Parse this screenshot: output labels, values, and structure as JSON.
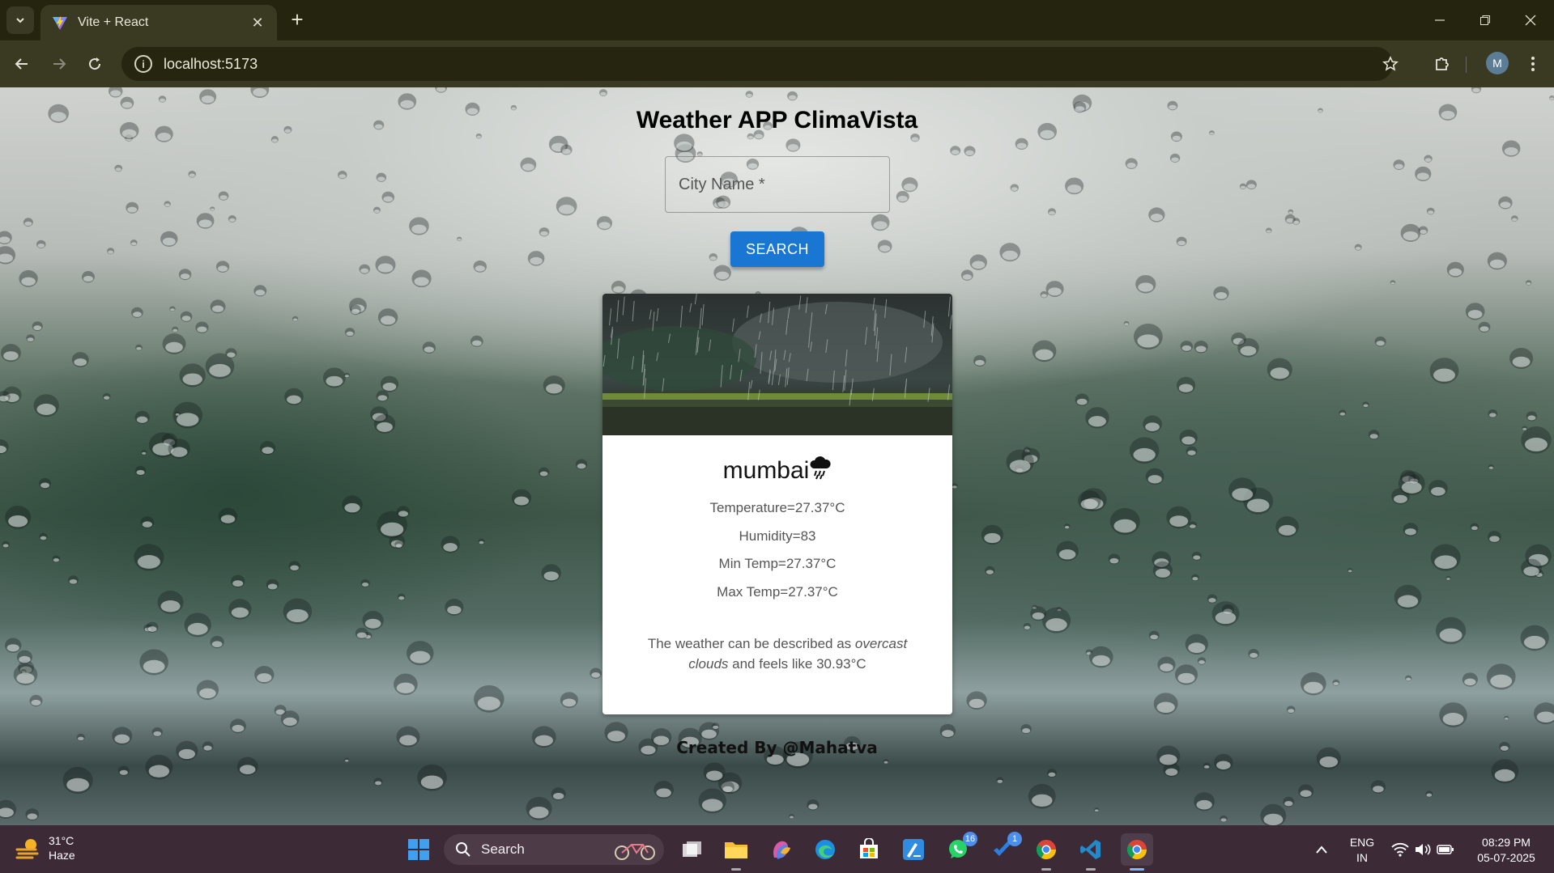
{
  "browser": {
    "tab_title": "Vite + React",
    "url": "localhost:5173",
    "profile_initial": "M"
  },
  "app": {
    "title": "Weather APP ClimaVista",
    "search": {
      "placeholder": "City Name *",
      "value": "",
      "button_label": "SEARCH"
    },
    "card": {
      "city": "mumbai",
      "condition_icon": "rain-cloud-icon",
      "temperature": "Temperature=27.37°C",
      "humidity": "Humidity=83",
      "min_temp": "Min Temp=27.37°C",
      "max_temp": "Max Temp=27.37°C",
      "desc_prefix": "The weather can be described as ",
      "desc_condition": "overcast clouds",
      "desc_suffix": " and feels like 30.93°C"
    },
    "credit": "Created By @Mahatva"
  },
  "taskbar": {
    "weather_temp": "31°C",
    "weather_cond": "Haze",
    "search_label": "Search",
    "whatsapp_badge": "16",
    "todo_badge": "1",
    "lang_line1": "ENG",
    "lang_line2": "IN",
    "time": "08:29 PM",
    "date": "05-07-2025"
  },
  "colors": {
    "accent": "#1976d2",
    "taskbar": "#3c2a37",
    "browser_frame": "#25240f"
  }
}
